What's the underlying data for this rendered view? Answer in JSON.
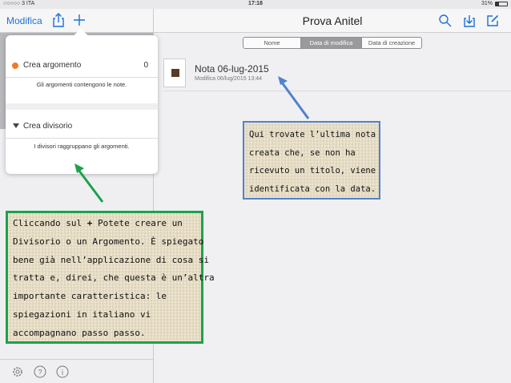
{
  "statusbar": {
    "carrier": "○○○○○ 3 ITA",
    "time": "17:18",
    "battery": "31%"
  },
  "sidebar": {
    "edit_label": "Modifica",
    "popover": {
      "rows": [
        {
          "label": "Crea argomento",
          "count": "0",
          "description": "Gli argomenti contengono le note."
        },
        {
          "label": "Crea divisorio",
          "description": "I divisori raggruppano gli argomenti."
        }
      ]
    }
  },
  "main": {
    "title": "Prova Anitel",
    "sort_segments": [
      "Nome",
      "Data di modifica",
      "Data di creazione"
    ],
    "active_segment": "Data di modifica",
    "note": {
      "title": "Nota 06-lug-2015",
      "subtitle": "Modifica 06/lug/2015 13:44"
    }
  },
  "callouts": {
    "blue": [
      "Qui trovate l’ultima nota",
      "creata che, se non ha",
      "ricevuto un titolo, viene",
      "identificata con la data."
    ],
    "green": {
      "line1_pre": "Cliccando sul ",
      "line1_bold": "+",
      "line1_post": " Potete creare un",
      "lines": [
        "Divisorio o un Argomento. È spiegato",
        "bene già nell’applicazione di cosa si",
        "tratta e, direi, che questa è un’altra",
        "importante caratteristica: le",
        "spiegazioni in italiano vi",
        "accompagnano passo passo."
      ]
    }
  },
  "colors": {
    "accent": "#1d6fd8",
    "callout_blue_border": "#4f82d0",
    "callout_green_border": "#1aa34a",
    "topic_dot": "#ef7a2a"
  },
  "icons": [
    "share-icon",
    "plus-icon",
    "search-icon",
    "download-icon",
    "compose-icon",
    "gear-icon",
    "help-icon",
    "info-icon",
    "wifi-icon",
    "battery-icon"
  ]
}
